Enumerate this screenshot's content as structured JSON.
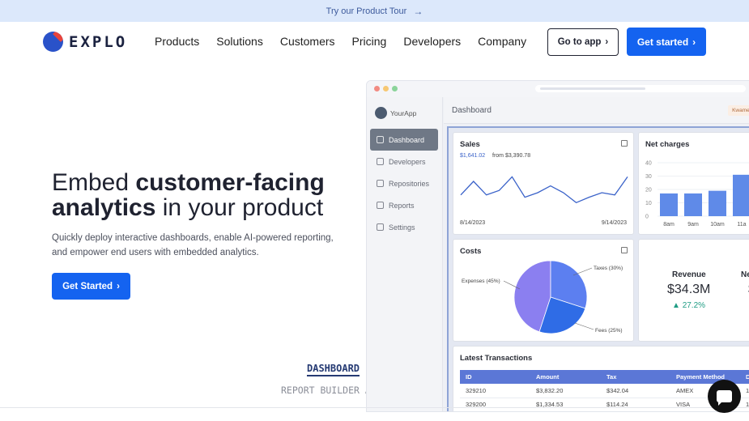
{
  "announcement": {
    "text": "Try our Product Tour",
    "arrow": "→"
  },
  "brand": {
    "name": "EXPLO",
    "accent": "#1463f0",
    "logo_red": "#e8433b"
  },
  "nav": {
    "links": [
      "Products",
      "Solutions",
      "Customers",
      "Pricing",
      "Developers",
      "Company"
    ],
    "go_to_app": "Go to app",
    "get_started": "Get started",
    "chevron": "›"
  },
  "hero": {
    "title_part1": "Embed ",
    "title_bold1": "customer-facing",
    "title_bold2": "analytics",
    "title_part2": " in your product",
    "subtitle": "Quickly deploy interactive dashboards, enable AI-powered reporting, and empower end users with embedded analytics.",
    "cta": "Get Started"
  },
  "stamps": {
    "line1": "DASHBOARD",
    "line2": "REPORT BUILDER AI"
  },
  "app": {
    "brand": "YourApp",
    "header_title": "Dashboard",
    "user": "Kwame M",
    "sidebar": [
      {
        "label": "Dashboard",
        "active": true
      },
      {
        "label": "Developers",
        "active": false
      },
      {
        "label": "Repositories",
        "active": false
      },
      {
        "label": "Reports",
        "active": false
      },
      {
        "label": "Settings",
        "active": false
      }
    ],
    "sales": {
      "title": "Sales",
      "value": "$1,641.02",
      "compare": "from $3,390.78",
      "start_date": "8/14/2023",
      "end_date": "9/14/2023",
      "line_color": "#3a62c9"
    },
    "net_charges": {
      "title": "Net charges",
      "ticks": [
        "40",
        "30",
        "20",
        "10",
        "0"
      ],
      "categories": [
        "8am",
        "9am",
        "10am",
        "11a"
      ],
      "values": [
        17,
        17,
        19,
        31
      ],
      "bar_color": "#5f8ae8"
    },
    "costs": {
      "title": "Costs",
      "slices": [
        {
          "label": "Expenses (45%)",
          "value": 45,
          "color": "#8b7ff0"
        },
        {
          "label": "Taxes (30%)",
          "value": 30,
          "color": "#5c7ff0"
        },
        {
          "label": "Fees (25%)",
          "value": 25,
          "color": "#2f6ce6"
        }
      ]
    },
    "revenue": {
      "title": "Revenue",
      "value": "$34.3M",
      "change": "27.2%",
      "partial_title": "Ne",
      "partial_value": "$"
    },
    "transactions": {
      "title": "Latest Transactions",
      "columns": [
        "ID",
        "Amount",
        "Tax",
        "Payment Method",
        "De"
      ],
      "rows": [
        [
          "329210",
          "$3,832.20",
          "$342.04",
          "AMEX",
          "1"
        ],
        [
          "329200",
          "$1,334.53",
          "$114.24",
          "VISA",
          "1"
        ]
      ]
    }
  }
}
